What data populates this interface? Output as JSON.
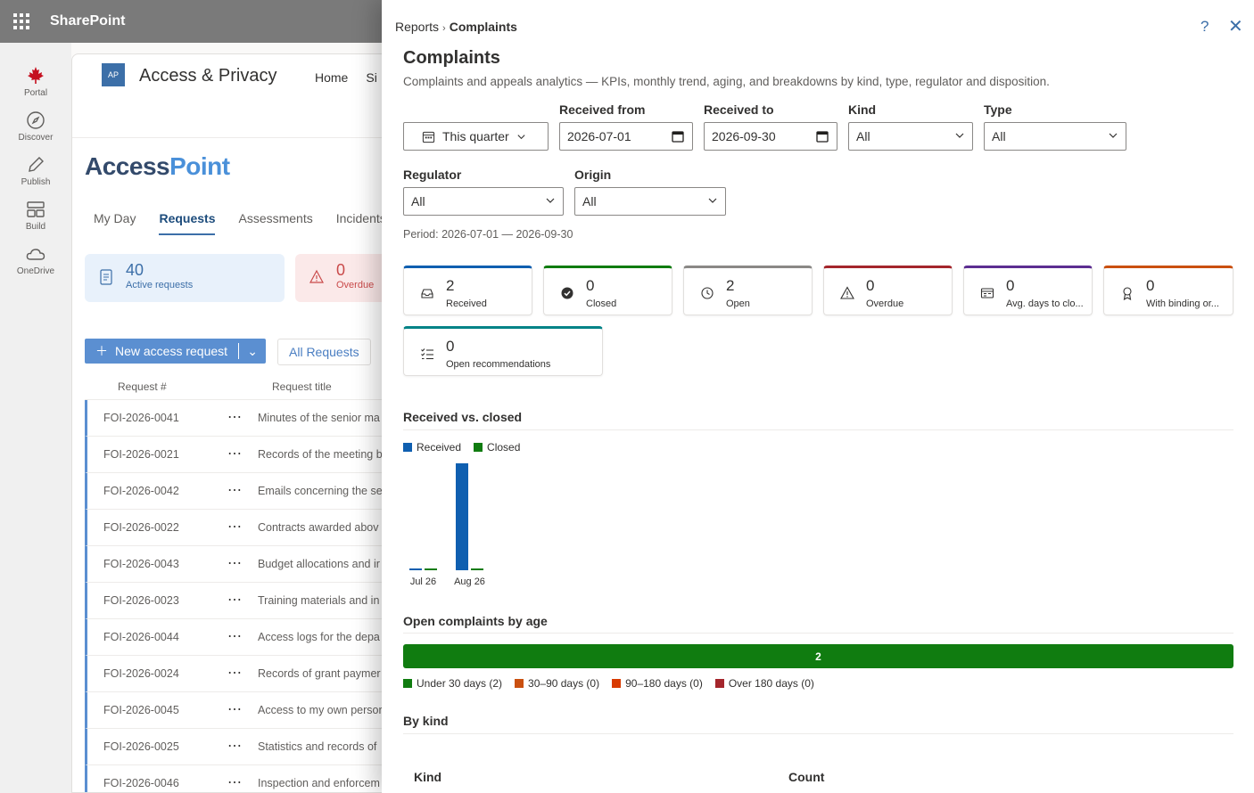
{
  "suite": {
    "title": "SharePoint"
  },
  "appbar": [
    {
      "label": "Portal",
      "icon": "maple-leaf-icon"
    },
    {
      "label": "Discover",
      "icon": "compass-icon"
    },
    {
      "label": "Publish",
      "icon": "pen-icon"
    },
    {
      "label": "Build",
      "icon": "layout-icon"
    },
    {
      "label": "OneDrive",
      "icon": "cloud-icon"
    }
  ],
  "site": {
    "logo": "AP",
    "name": "Access & Privacy",
    "nav": [
      "Home",
      "Si"
    ],
    "brand_a": "Access",
    "brand_b": "Point",
    "tabs": [
      "My Day",
      "Requests",
      "Assessments",
      "Incidents"
    ],
    "active_tab": "Requests",
    "tiles": [
      {
        "value": "40",
        "label": "Active requests"
      },
      {
        "value": "0",
        "label": "Overdue"
      }
    ],
    "new_button": "New access request",
    "view_label": "All Requests",
    "columns": [
      "Request #",
      "Request title"
    ],
    "rows": [
      {
        "id": "FOI-2026-0041",
        "title": "Minutes of the senior ma"
      },
      {
        "id": "FOI-2026-0021",
        "title": "Records of the meeting b"
      },
      {
        "id": "FOI-2026-0042",
        "title": "Emails concerning the se"
      },
      {
        "id": "FOI-2026-0022",
        "title": "Contracts awarded abov"
      },
      {
        "id": "FOI-2026-0043",
        "title": "Budget allocations and ir"
      },
      {
        "id": "FOI-2026-0023",
        "title": "Training materials and in"
      },
      {
        "id": "FOI-2026-0044",
        "title": "Access logs for the depa"
      },
      {
        "id": "FOI-2026-0024",
        "title": "Records of grant paymer"
      },
      {
        "id": "FOI-2026-0045",
        "title": "Access to my own persor"
      },
      {
        "id": "FOI-2026-0025",
        "title": "Statistics and records of"
      },
      {
        "id": "FOI-2026-0046",
        "title": "Inspection and enforcem"
      }
    ]
  },
  "panel": {
    "breadcrumb": {
      "parent": "Reports",
      "separator": "›",
      "current": "Complaints"
    },
    "help": "?",
    "close": "✕",
    "title": "Complaints",
    "subtitle": "Complaints and appeals analytics — KPIs, monthly trend, aging, and breakdowns by kind, type, regulator and disposition.",
    "filters": {
      "range_button": "This quarter",
      "received_from_label": "Received from",
      "received_from": "2026-07-01",
      "received_to_label": "Received to",
      "received_to": "2026-09-30",
      "kind_label": "Kind",
      "kind": "All",
      "type_label": "Type",
      "type": "All",
      "regulator_label": "Regulator",
      "regulator": "All",
      "origin_label": "Origin",
      "origin": "All"
    },
    "period": "Period: 2026-07-01 — 2026-09-30",
    "kpis": [
      {
        "value": "2",
        "label": "Received",
        "color": "#0f5fb0",
        "icon": "inbox-icon"
      },
      {
        "value": "0",
        "label": "Closed",
        "color": "#107c10",
        "icon": "check-circle-icon"
      },
      {
        "value": "2",
        "label": "Open",
        "color": "#8a8886",
        "icon": "clock-icon"
      },
      {
        "value": "0",
        "label": "Overdue",
        "color": "#a4262c",
        "icon": "warning-icon"
      },
      {
        "value": "0",
        "label": "Avg. days to clo...",
        "color": "#5c2e91",
        "icon": "calendar-icon"
      },
      {
        "value": "0",
        "label": "With binding or...",
        "color": "#ca5010",
        "icon": "ribbon-icon"
      },
      {
        "value": "0",
        "label": "Open recommendations",
        "color": "#038387",
        "icon": "checklist-icon"
      }
    ],
    "trend_title": "Received vs. closed",
    "age_title": "Open complaints by age",
    "age_buckets": [
      {
        "label": "Under 30 days (2)",
        "value": 2,
        "color": "#107c10"
      },
      {
        "label": "30–90 days (0)",
        "value": 0,
        "color": "#ca5010"
      },
      {
        "label": "90–180 days (0)",
        "value": 0,
        "color": "#d83b01"
      },
      {
        "label": "Over 180 days (0)",
        "value": 0,
        "color": "#a4262c"
      }
    ],
    "age_bar_text": "2",
    "kind_title": "By kind",
    "kind_columns": [
      "Kind",
      "Count"
    ]
  },
  "chart_data": {
    "type": "bar",
    "title": "Received vs. closed",
    "categories": [
      "Jul 26",
      "Aug 26"
    ],
    "series": [
      {
        "name": "Received",
        "values": [
          0,
          2
        ],
        "color": "#0f5fb0"
      },
      {
        "name": "Closed",
        "values": [
          0,
          0
        ],
        "color": "#107c10"
      }
    ],
    "ylim": [
      0,
      2
    ],
    "grid": false,
    "legend": "top-left"
  }
}
